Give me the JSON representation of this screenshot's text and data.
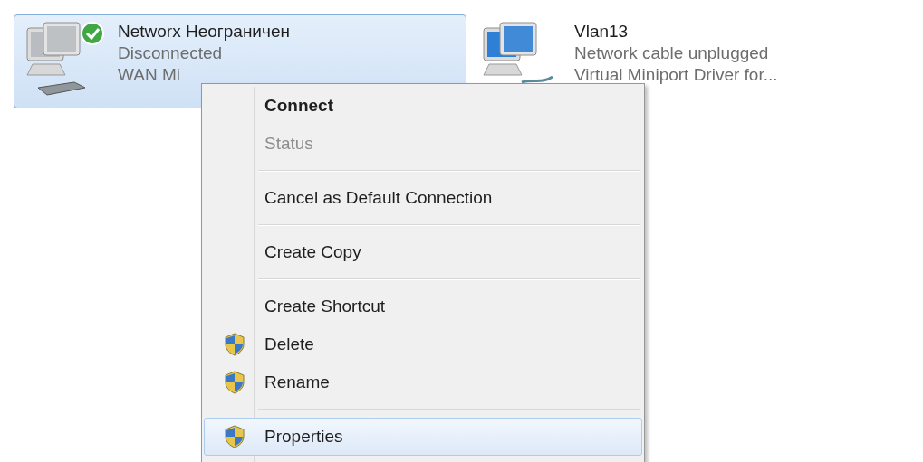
{
  "adapters": [
    {
      "name": "Networx Неограничен",
      "status": "Disconnected",
      "device": "WAN Mi",
      "kind": "wan",
      "default": true,
      "selected": true
    },
    {
      "name": "Vlan13",
      "status": "Network cable unplugged",
      "device": "Virtual Miniport Driver for...",
      "kind": "lan",
      "default": false,
      "selected": false
    }
  ],
  "context_menu": {
    "items": [
      {
        "kind": "command",
        "label": "Connect",
        "bold": true,
        "disabled": false,
        "shield": false,
        "selected": false
      },
      {
        "kind": "command",
        "label": "Status",
        "bold": false,
        "disabled": true,
        "shield": false,
        "selected": false
      },
      {
        "kind": "separator"
      },
      {
        "kind": "command",
        "label": "Cancel as Default Connection",
        "bold": false,
        "disabled": false,
        "shield": false,
        "selected": false
      },
      {
        "kind": "separator"
      },
      {
        "kind": "command",
        "label": "Create Copy",
        "bold": false,
        "disabled": false,
        "shield": false,
        "selected": false
      },
      {
        "kind": "separator"
      },
      {
        "kind": "command",
        "label": "Create Shortcut",
        "bold": false,
        "disabled": false,
        "shield": false,
        "selected": false
      },
      {
        "kind": "command",
        "label": "Delete",
        "bold": false,
        "disabled": false,
        "shield": true,
        "selected": false
      },
      {
        "kind": "command",
        "label": "Rename",
        "bold": false,
        "disabled": false,
        "shield": true,
        "selected": false
      },
      {
        "kind": "separator"
      },
      {
        "kind": "command",
        "label": "Properties",
        "bold": false,
        "disabled": false,
        "shield": true,
        "selected": true
      }
    ]
  }
}
